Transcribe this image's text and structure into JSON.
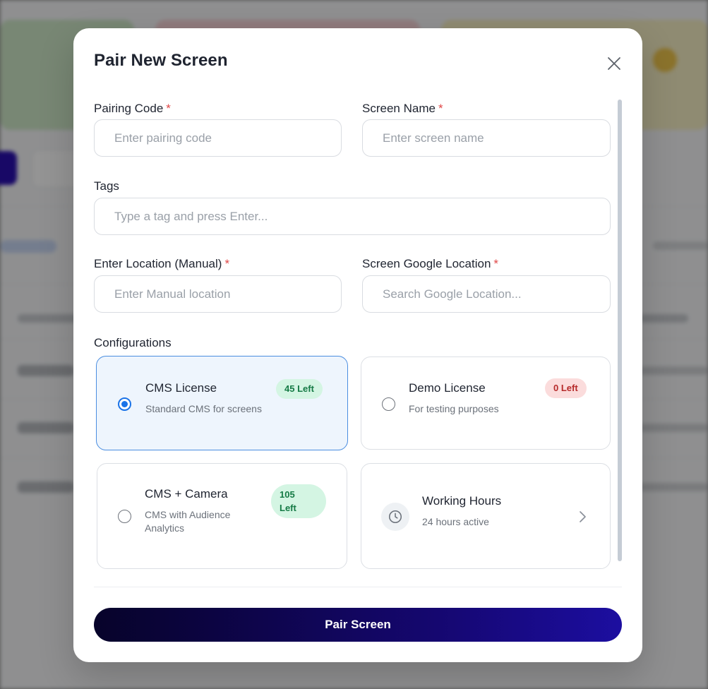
{
  "modal": {
    "title": "Pair New Screen",
    "close_icon": "close-icon"
  },
  "fields": {
    "pairing_code": {
      "label": "Pairing Code",
      "required_mark": "*",
      "placeholder": "Enter pairing code",
      "value": ""
    },
    "screen_name": {
      "label": "Screen Name",
      "required_mark": "*",
      "placeholder": "Enter screen name",
      "value": ""
    },
    "tags": {
      "label": "Tags",
      "placeholder": "Type a tag and press Enter...",
      "value": ""
    },
    "manual_location": {
      "label": "Enter Location (Manual)",
      "required_mark": "*",
      "placeholder": "Enter Manual location",
      "value": ""
    },
    "google_location": {
      "label": "Screen Google Location",
      "required_mark": "*",
      "placeholder": "Search Google Location...",
      "value": ""
    }
  },
  "configurations": {
    "label": "Configurations",
    "options": [
      {
        "title": "CMS License",
        "subtitle": "Standard CMS for screens",
        "badge": "45 Left",
        "badge_color": "green",
        "selected": true
      },
      {
        "title": "Demo License",
        "subtitle": "For testing purposes",
        "badge": "0 Left",
        "badge_color": "red",
        "selected": false
      },
      {
        "title": "CMS + Camera",
        "subtitle_line1": "CMS with Audience",
        "subtitle_line2": "Analytics",
        "badge_line1": "105",
        "badge_line2": "Left",
        "badge_color": "green",
        "selected": false
      }
    ],
    "working_hours": {
      "title": "Working Hours",
      "subtitle": "24 hours active",
      "icon": "clock-icon",
      "chevron": "chevron-right-icon"
    }
  },
  "submit": {
    "label": "Pair Screen"
  },
  "colors": {
    "accent": "#1a73e8",
    "button_gradient_start": "#07032a",
    "button_gradient_end": "#1c0ea0",
    "badge_green_bg": "#d4f5e3",
    "badge_red_bg": "#fbdcdc",
    "required": "#e04848"
  }
}
